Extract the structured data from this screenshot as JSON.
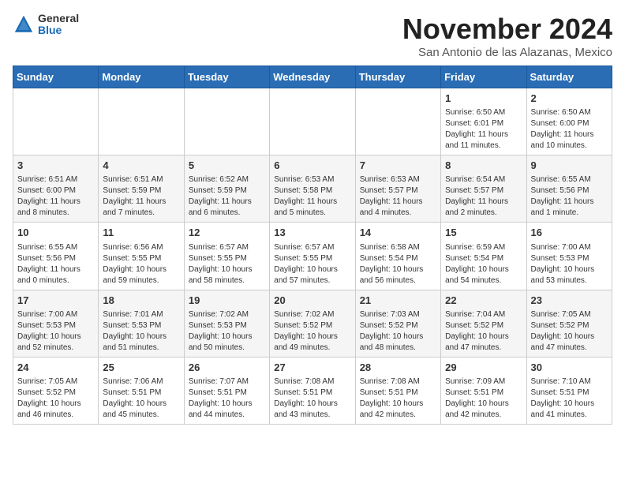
{
  "header": {
    "logo_general": "General",
    "logo_blue": "Blue",
    "title": "November 2024",
    "location": "San Antonio de las Alazanas, Mexico"
  },
  "days_of_week": [
    "Sunday",
    "Monday",
    "Tuesday",
    "Wednesday",
    "Thursday",
    "Friday",
    "Saturday"
  ],
  "weeks": [
    [
      {
        "day": "",
        "info": ""
      },
      {
        "day": "",
        "info": ""
      },
      {
        "day": "",
        "info": ""
      },
      {
        "day": "",
        "info": ""
      },
      {
        "day": "",
        "info": ""
      },
      {
        "day": "1",
        "info": "Sunrise: 6:50 AM\nSunset: 6:01 PM\nDaylight: 11 hours and 11 minutes."
      },
      {
        "day": "2",
        "info": "Sunrise: 6:50 AM\nSunset: 6:00 PM\nDaylight: 11 hours and 10 minutes."
      }
    ],
    [
      {
        "day": "3",
        "info": "Sunrise: 6:51 AM\nSunset: 6:00 PM\nDaylight: 11 hours and 8 minutes."
      },
      {
        "day": "4",
        "info": "Sunrise: 6:51 AM\nSunset: 5:59 PM\nDaylight: 11 hours and 7 minutes."
      },
      {
        "day": "5",
        "info": "Sunrise: 6:52 AM\nSunset: 5:59 PM\nDaylight: 11 hours and 6 minutes."
      },
      {
        "day": "6",
        "info": "Sunrise: 6:53 AM\nSunset: 5:58 PM\nDaylight: 11 hours and 5 minutes."
      },
      {
        "day": "7",
        "info": "Sunrise: 6:53 AM\nSunset: 5:57 PM\nDaylight: 11 hours and 4 minutes."
      },
      {
        "day": "8",
        "info": "Sunrise: 6:54 AM\nSunset: 5:57 PM\nDaylight: 11 hours and 2 minutes."
      },
      {
        "day": "9",
        "info": "Sunrise: 6:55 AM\nSunset: 5:56 PM\nDaylight: 11 hours and 1 minute."
      }
    ],
    [
      {
        "day": "10",
        "info": "Sunrise: 6:55 AM\nSunset: 5:56 PM\nDaylight: 11 hours and 0 minutes."
      },
      {
        "day": "11",
        "info": "Sunrise: 6:56 AM\nSunset: 5:55 PM\nDaylight: 10 hours and 59 minutes."
      },
      {
        "day": "12",
        "info": "Sunrise: 6:57 AM\nSunset: 5:55 PM\nDaylight: 10 hours and 58 minutes."
      },
      {
        "day": "13",
        "info": "Sunrise: 6:57 AM\nSunset: 5:55 PM\nDaylight: 10 hours and 57 minutes."
      },
      {
        "day": "14",
        "info": "Sunrise: 6:58 AM\nSunset: 5:54 PM\nDaylight: 10 hours and 56 minutes."
      },
      {
        "day": "15",
        "info": "Sunrise: 6:59 AM\nSunset: 5:54 PM\nDaylight: 10 hours and 54 minutes."
      },
      {
        "day": "16",
        "info": "Sunrise: 7:00 AM\nSunset: 5:53 PM\nDaylight: 10 hours and 53 minutes."
      }
    ],
    [
      {
        "day": "17",
        "info": "Sunrise: 7:00 AM\nSunset: 5:53 PM\nDaylight: 10 hours and 52 minutes."
      },
      {
        "day": "18",
        "info": "Sunrise: 7:01 AM\nSunset: 5:53 PM\nDaylight: 10 hours and 51 minutes."
      },
      {
        "day": "19",
        "info": "Sunrise: 7:02 AM\nSunset: 5:53 PM\nDaylight: 10 hours and 50 minutes."
      },
      {
        "day": "20",
        "info": "Sunrise: 7:02 AM\nSunset: 5:52 PM\nDaylight: 10 hours and 49 minutes."
      },
      {
        "day": "21",
        "info": "Sunrise: 7:03 AM\nSunset: 5:52 PM\nDaylight: 10 hours and 48 minutes."
      },
      {
        "day": "22",
        "info": "Sunrise: 7:04 AM\nSunset: 5:52 PM\nDaylight: 10 hours and 47 minutes."
      },
      {
        "day": "23",
        "info": "Sunrise: 7:05 AM\nSunset: 5:52 PM\nDaylight: 10 hours and 47 minutes."
      }
    ],
    [
      {
        "day": "24",
        "info": "Sunrise: 7:05 AM\nSunset: 5:52 PM\nDaylight: 10 hours and 46 minutes."
      },
      {
        "day": "25",
        "info": "Sunrise: 7:06 AM\nSunset: 5:51 PM\nDaylight: 10 hours and 45 minutes."
      },
      {
        "day": "26",
        "info": "Sunrise: 7:07 AM\nSunset: 5:51 PM\nDaylight: 10 hours and 44 minutes."
      },
      {
        "day": "27",
        "info": "Sunrise: 7:08 AM\nSunset: 5:51 PM\nDaylight: 10 hours and 43 minutes."
      },
      {
        "day": "28",
        "info": "Sunrise: 7:08 AM\nSunset: 5:51 PM\nDaylight: 10 hours and 42 minutes."
      },
      {
        "day": "29",
        "info": "Sunrise: 7:09 AM\nSunset: 5:51 PM\nDaylight: 10 hours and 42 minutes."
      },
      {
        "day": "30",
        "info": "Sunrise: 7:10 AM\nSunset: 5:51 PM\nDaylight: 10 hours and 41 minutes."
      }
    ]
  ]
}
